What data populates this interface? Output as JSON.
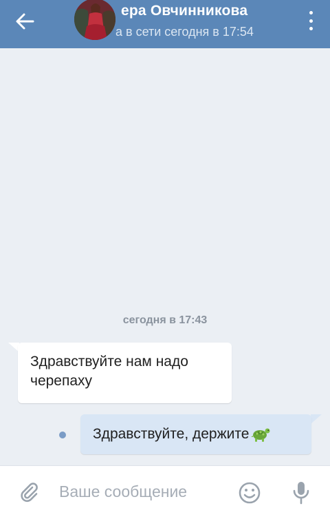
{
  "header": {
    "contact_name": "ера Овчинникова",
    "status": "а в сети сегодня в 17:54"
  },
  "chat": {
    "date_separator": "сегодня в 17:43",
    "messages": [
      {
        "direction": "incoming",
        "text": "Здравствуйте нам надо черепаху"
      },
      {
        "direction": "outgoing",
        "text": "Здравствуйте, держите",
        "emoji": "turtle-emoji",
        "unread": true
      }
    ]
  },
  "composer": {
    "placeholder": "Ваше сообщение",
    "value": ""
  },
  "icons": {
    "back": "arrow-left-icon",
    "more": "more-vertical-icon",
    "attach": "paperclip-icon",
    "emoji": "smiley-icon",
    "mic": "microphone-icon"
  },
  "colors": {
    "header": "#5b87b8",
    "chat_background": "#ebeff4",
    "incoming_bubble": "#ffffff",
    "outgoing_bubble": "#d9e6f5",
    "unread_dot": "#7a9cc6"
  }
}
